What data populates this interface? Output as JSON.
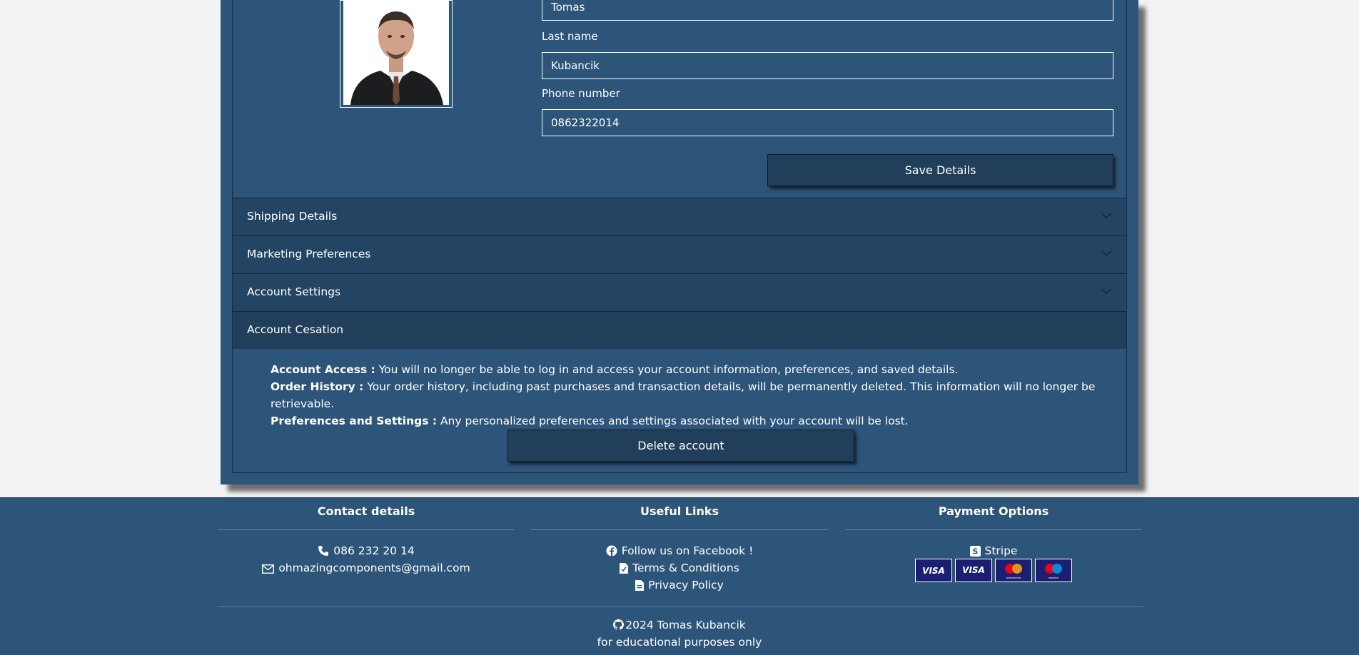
{
  "profile": {
    "first_name_value": "Tomas",
    "last_name_label": "Last name",
    "last_name_value": "Kubancik",
    "phone_label": "Phone number",
    "phone_value": "0862322014",
    "save_label": "Save Details"
  },
  "accordion": {
    "sections": [
      {
        "label": "Shipping Details",
        "icon": "chevron-down-icon"
      },
      {
        "label": "Marketing Preferences",
        "icon": "chevron-down-icon"
      },
      {
        "label": "Account Settings",
        "icon": "chevron-down-icon"
      },
      {
        "label": "Account Cesation"
      }
    ],
    "cessation": {
      "items": [
        {
          "term": "Account Access :",
          "text": " You will no longer be able to log in and access your account information, preferences, and saved details."
        },
        {
          "term": "Order History :",
          "text": " Your order history, including past purchases and transaction details, will be permanently deleted. This information will no longer be retrievable."
        },
        {
          "term": "Preferences and Settings :",
          "text": " Any personalized preferences and settings associated with your account will be lost."
        }
      ],
      "delete_label": "Delete account"
    }
  },
  "footer": {
    "contact": {
      "heading": "Contact details",
      "phone": "086 232 20 14",
      "email": "ohmazingcomponents@gmail.com"
    },
    "links": {
      "heading": "Useful Links",
      "facebook": "Follow us on Facebook !",
      "terms": "Terms & Conditions",
      "privacy": "Privacy Policy"
    },
    "payment": {
      "heading": "Payment Options",
      "stripe": "Stripe",
      "cards": [
        "VISA",
        "VISA",
        "mastercard",
        "maestro"
      ]
    },
    "copyright": "2024 Tomas Kubancik",
    "note": "for educational purposes only"
  },
  "colors": {
    "panel": "#2d5479",
    "header": "#234563",
    "button": "#213e5a",
    "page": "#f3f3f3"
  }
}
